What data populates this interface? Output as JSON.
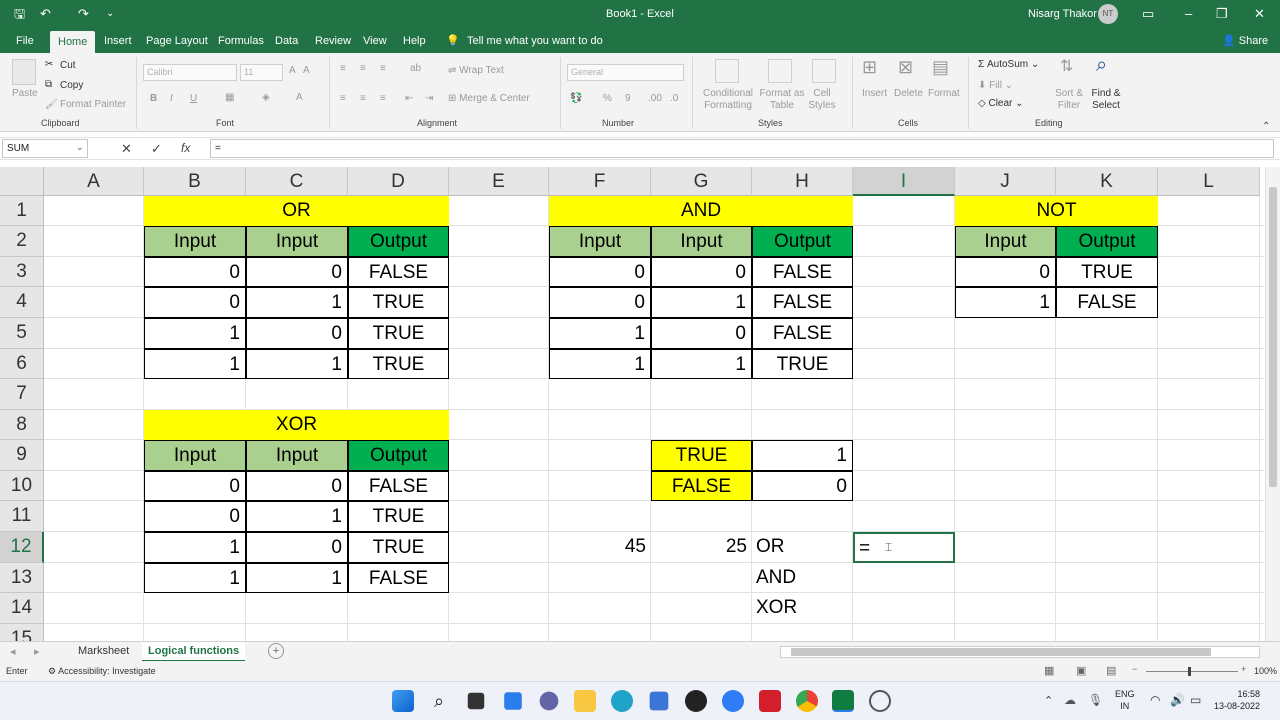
{
  "window": {
    "title": "Book1  -  Excel",
    "user": "Nisarg Thakor",
    "user_initials": "NT"
  },
  "ribbon_tabs": [
    "File",
    "Home",
    "Insert",
    "Page Layout",
    "Formulas",
    "Data",
    "Review",
    "View",
    "Help"
  ],
  "tell_me": "Tell me what you want to do",
  "share": "Share",
  "clipboard": {
    "paste": "Paste",
    "cut": "Cut",
    "copy": "Copy",
    "format_painter": "Format Painter",
    "label": "Clipboard"
  },
  "font": {
    "name": "Calibri",
    "size": "11",
    "label": "Font"
  },
  "alignment": {
    "wrap": "Wrap Text",
    "merge": "Merge & Center",
    "label": "Alignment"
  },
  "number": {
    "format": "General",
    "label": "Number"
  },
  "styles": {
    "cond": "Conditional Formatting",
    "fmt_table": "Format as Table",
    "cell_styles": "Cell Styles",
    "label": "Styles"
  },
  "cells": {
    "insert": "Insert",
    "delete": "Delete",
    "format": "Format",
    "label": "Cells"
  },
  "editing": {
    "autosum": "AutoSum",
    "fill": "Fill",
    "clear": "Clear",
    "sort": "Sort & Filter",
    "find": "Find & Select",
    "label": "Editing"
  },
  "formula_bar": {
    "name_box": "SUM",
    "formula": "="
  },
  "columns": [
    "A",
    "B",
    "C",
    "D",
    "E",
    "F",
    "G",
    "H",
    "I",
    "J",
    "K",
    "L"
  ],
  "rows": [
    "1",
    "2",
    "3",
    "4",
    "5",
    "6",
    "7",
    "8",
    "9",
    "10",
    "11",
    "12",
    "13",
    "14",
    "15"
  ],
  "or_table": {
    "title": "OR",
    "headers": [
      "Input",
      "Input",
      "Output"
    ],
    "rows": [
      [
        "0",
        "0",
        "FALSE"
      ],
      [
        "0",
        "1",
        "TRUE"
      ],
      [
        "1",
        "0",
        "TRUE"
      ],
      [
        "1",
        "1",
        "TRUE"
      ]
    ]
  },
  "and_table": {
    "title": "AND",
    "headers": [
      "Input",
      "Input",
      "Output"
    ],
    "rows": [
      [
        "0",
        "0",
        "FALSE"
      ],
      [
        "0",
        "1",
        "FALSE"
      ],
      [
        "1",
        "0",
        "FALSE"
      ],
      [
        "1",
        "1",
        "TRUE"
      ]
    ]
  },
  "not_table": {
    "title": "NOT",
    "headers": [
      "Input",
      "Output"
    ],
    "rows": [
      [
        "0",
        "TRUE"
      ],
      [
        "1",
        "FALSE"
      ]
    ]
  },
  "xor_table": {
    "title": "XOR",
    "headers": [
      "Input",
      "Input",
      "Output"
    ],
    "rows": [
      [
        "0",
        "0",
        "FALSE"
      ],
      [
        "0",
        "1",
        "TRUE"
      ],
      [
        "1",
        "0",
        "TRUE"
      ],
      [
        "1",
        "1",
        "FALSE"
      ]
    ]
  },
  "bool_table": {
    "rows": [
      [
        "TRUE",
        "1"
      ],
      [
        "FALSE",
        "0"
      ]
    ]
  },
  "extra": {
    "f12": "45",
    "g12": "25",
    "h12": "OR",
    "h13": "AND",
    "h14": "XOR",
    "i12": "="
  },
  "sheets": [
    "Marksheet",
    "Logical functions"
  ],
  "status": {
    "mode": "Enter",
    "accessibility": "Accessibility: Investigate",
    "zoom": "100%"
  },
  "taskbar": {
    "lang1": "ENG",
    "lang2": "IN",
    "time": "16:58",
    "date": "13-08-2022"
  }
}
